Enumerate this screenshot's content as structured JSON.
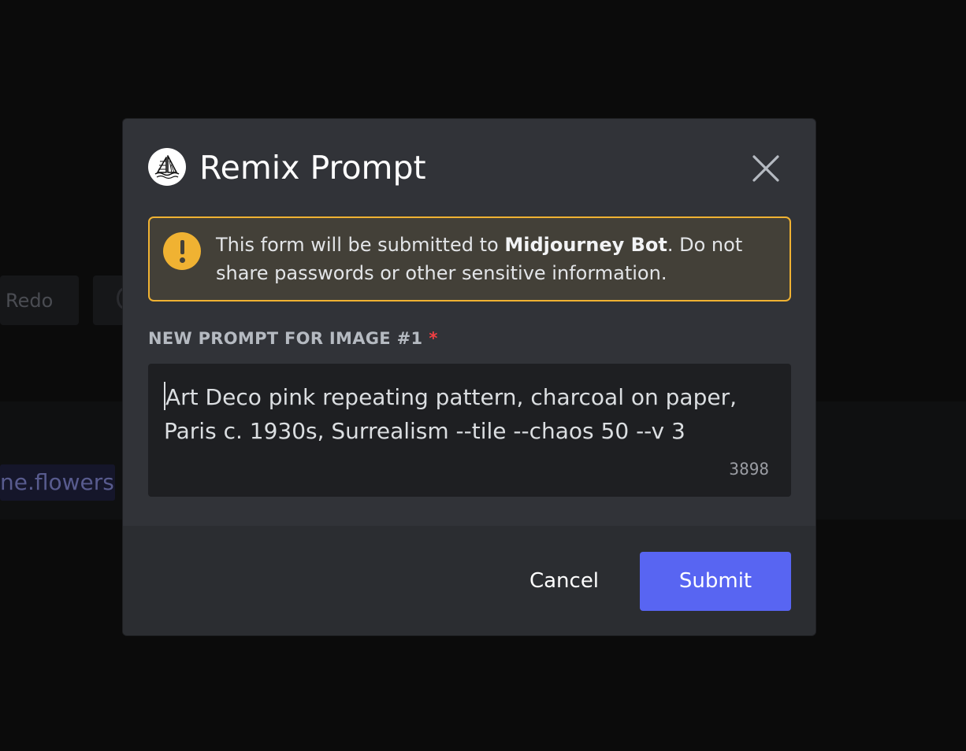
{
  "background": {
    "redo_label": "Redo",
    "chip_label": "ne.flowers"
  },
  "modal": {
    "title": "Remix Prompt",
    "avatar_icon": "midjourney-sailboat-icon",
    "close_icon": "close-icon"
  },
  "warning": {
    "icon": "exclamation-icon",
    "text_before": "This form will be submitted to ",
    "bot_name": "Midjourney Bot",
    "text_after": ". Do not share passwords or other sensitive information.",
    "border_color": "#f0b232"
  },
  "field": {
    "label": "NEW PROMPT FOR IMAGE #1",
    "required_marker": "*",
    "value": "Art Deco pink repeating pattern, charcoal on paper, Paris c. 1930s, Surrealism --tile --chaos 50 --v 3",
    "remaining_chars": "3898"
  },
  "footer": {
    "cancel_label": "Cancel",
    "submit_label": "Submit",
    "submit_color": "#5865f2"
  }
}
